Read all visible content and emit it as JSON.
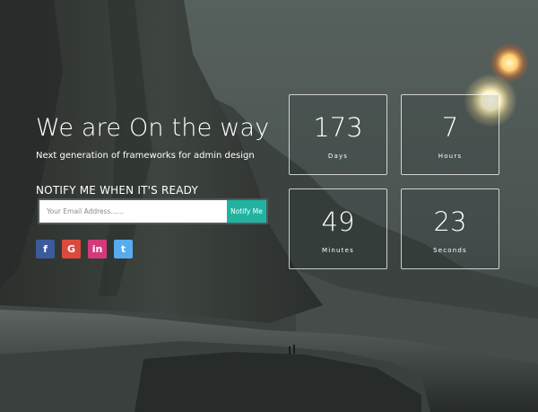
{
  "hero": {
    "title": "We are On the way",
    "subtitle": "Next generation of frameworks for admin design",
    "notify_heading": "NOTIFY ME WHEN IT'S READY"
  },
  "form": {
    "email_placeholder": "Your Email Address......",
    "button_label": "Notify Me"
  },
  "social": [
    {
      "name": "facebook-icon",
      "glyph": "f",
      "color": "#3b5a9b"
    },
    {
      "name": "google-plus-icon",
      "glyph": "G",
      "color": "#dc4a3e"
    },
    {
      "name": "linkedin-icon",
      "glyph": "in",
      "color": "#d43a7b"
    },
    {
      "name": "twitter-icon",
      "glyph": "t",
      "color": "#55acee"
    }
  ],
  "countdown": {
    "days": {
      "value": "173",
      "label": "Days"
    },
    "hours": {
      "value": "7",
      "label": "Hours"
    },
    "minutes": {
      "value": "49",
      "label": "Minutes"
    },
    "seconds": {
      "value": "23",
      "label": "Seconds"
    }
  },
  "colors": {
    "accent": "#22b3a0"
  }
}
